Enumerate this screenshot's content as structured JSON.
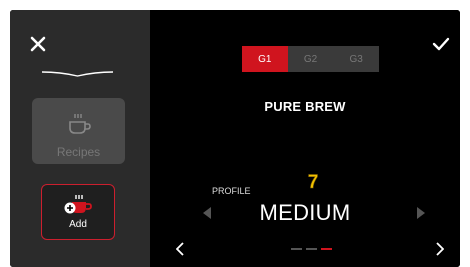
{
  "sidebar": {
    "recipes_label": "Recipes",
    "add_label": "Add"
  },
  "main": {
    "grinder_tabs": [
      {
        "label": "G1",
        "active": true
      },
      {
        "label": "G2",
        "active": false
      },
      {
        "label": "G3",
        "active": false
      }
    ],
    "title": "PURE BREW",
    "profile": {
      "label": "PROFILE",
      "number": "7",
      "value": "MEDIUM"
    },
    "pager": {
      "count": 3,
      "active_index": 2
    }
  },
  "colors": {
    "accent": "#d0141e",
    "sidebar_bg": "#2b2b2b",
    "background": "#000000",
    "number_yellow": "#f2c200"
  },
  "icons": [
    "close-icon",
    "check-icon",
    "cup-icon",
    "add-cup-icon",
    "chevron-left-icon",
    "chevron-right-icon",
    "triangle-left-icon",
    "triangle-right-icon"
  ]
}
